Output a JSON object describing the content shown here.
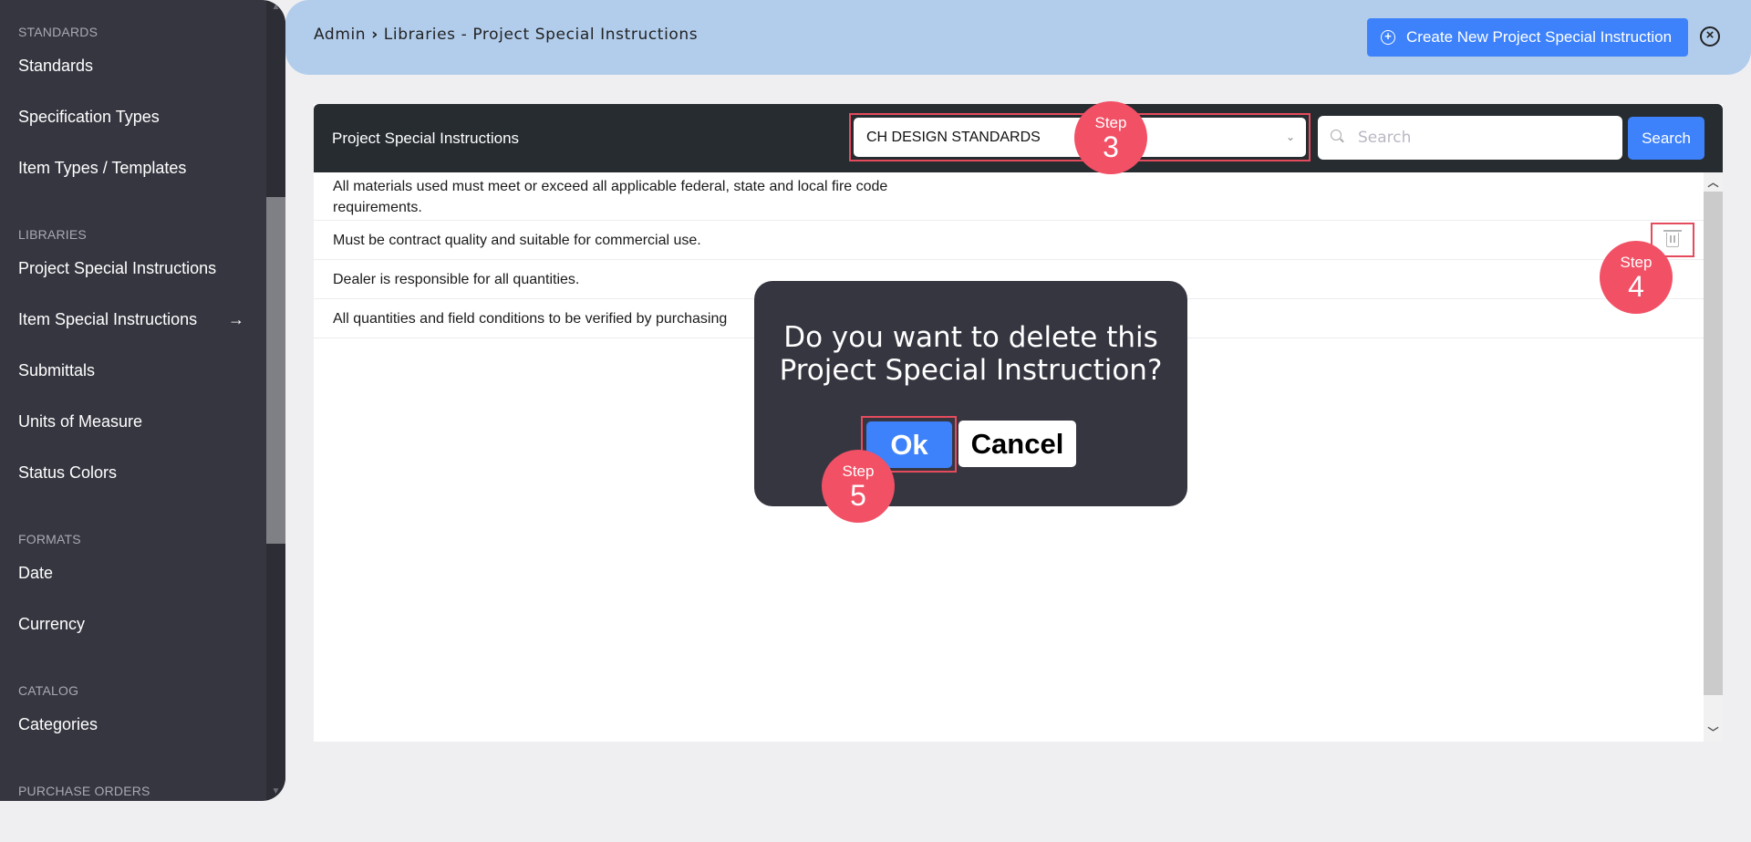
{
  "sidebar": {
    "sections": [
      {
        "title": "STANDARDS",
        "items": [
          {
            "label": "Standards"
          },
          {
            "label": "Specification Types"
          },
          {
            "label": "Item Types / Templates"
          }
        ]
      },
      {
        "title": "LIBRARIES",
        "items": [
          {
            "label": "Project Special Instructions"
          },
          {
            "label": "Item Special Instructions",
            "icon": "arrow-right-icon",
            "glyph": "→"
          },
          {
            "label": "Submittals"
          },
          {
            "label": "Units of Measure"
          },
          {
            "label": "Status Colors"
          }
        ]
      },
      {
        "title": "FORMATS",
        "items": [
          {
            "label": "Date"
          },
          {
            "label": "Currency"
          }
        ]
      },
      {
        "title": "CATALOG",
        "items": [
          {
            "label": "Categories"
          }
        ]
      },
      {
        "title": "PURCHASE ORDERS",
        "items": []
      }
    ]
  },
  "header": {
    "breadcrumb_root": "Admin",
    "breadcrumb_sep": "›",
    "breadcrumb_page": "Libraries - Project Special Instructions",
    "create_button": "Create New Project Special Instruction",
    "create_icon": "+",
    "close_icon": "×"
  },
  "panel": {
    "title": "Project Special Instructions",
    "standard_select": {
      "value": "CH DESIGN STANDARDS",
      "chevron": "⌄"
    },
    "search": {
      "placeholder": "Search",
      "value": "",
      "button": "Search"
    },
    "rows": [
      {
        "text": "All materials used must meet or exceed all applicable federal, state and local fire code requirements."
      },
      {
        "text": "Must be contract quality and suitable for commercial use."
      },
      {
        "text": "Dealer is responsible for all quantities."
      },
      {
        "text": "All quantities and field conditions to be verified by purchasing"
      }
    ],
    "scroll_up": "⌃",
    "scroll_down": "⌄"
  },
  "dialog": {
    "message": "Do you want to delete this Project Special Instruction?",
    "ok": "Ok",
    "cancel": "Cancel"
  },
  "steps": [
    {
      "label": "Step",
      "number": "3"
    },
    {
      "label": "Step",
      "number": "4"
    },
    {
      "label": "Step",
      "number": "5"
    }
  ],
  "colors": {
    "accent": "#3d82fb",
    "step_marker": "#f25065",
    "highlight_border": "#e54b5c",
    "header_bg": "#b2cdec",
    "sidebar_bg": "#363641"
  }
}
